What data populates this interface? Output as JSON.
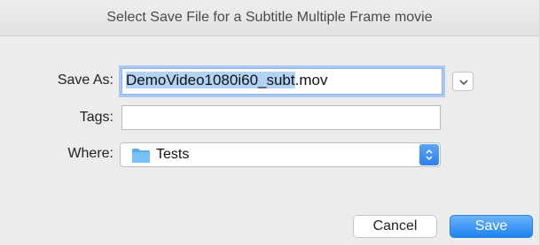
{
  "dialog": {
    "title": "Select Save File for a Subtitle Multiple Frame movie"
  },
  "form": {
    "save_as_label": "Save As:",
    "save_as_selected": "DemoVideo1080i60_subt",
    "save_as_extension": ".mov",
    "tags_label": "Tags:",
    "tags_value": "",
    "where_label": "Where:",
    "where_value": "Tests"
  },
  "buttons": {
    "cancel": "Cancel",
    "save": "Save"
  },
  "colors": {
    "accent": "#1e82f3",
    "selection": "#b3d3f5",
    "folder": "#5aaef0"
  }
}
